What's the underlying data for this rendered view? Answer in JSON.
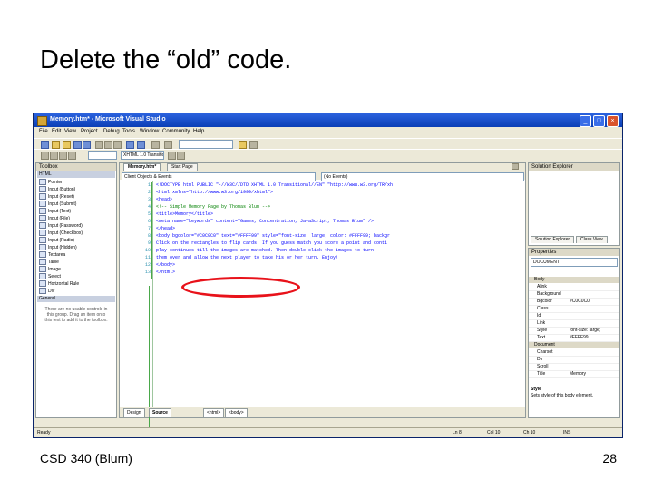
{
  "slide": {
    "title": "Delete the “old” code.",
    "footer_left": "CSD 340 (Blum)",
    "page_number": "28"
  },
  "window": {
    "title": "Memory.htm* - Microsoft Visual Studio",
    "menu": [
      "File",
      "Edit",
      "View",
      "Project",
      "Debug",
      "Tools",
      "Window",
      "Community",
      "Help"
    ],
    "toolbar_dropdown": "Client Objects & Events",
    "doc_dropdown": "(No Events)",
    "schema_dropdown": "XHTML 1.0 Transitional",
    "toolbox": {
      "title": "Toolbox",
      "group_html": "HTML",
      "items": [
        "Pointer",
        "Input (Button)",
        "Input (Reset)",
        "Input (Submit)",
        "Input (Text)",
        "Input (File)",
        "Input (Password)",
        "Input (Checkbox)",
        "Input (Radio)",
        "Input (Hidden)",
        "Textarea",
        "Table",
        "Image",
        "Select",
        "Horizontal Rule",
        "Div"
      ],
      "group_general": "General",
      "empty_message": "There are no usable controls in this group. Drag an item onto this text to add it to the toolbox."
    },
    "editor": {
      "tabs": [
        "Memory.htm*",
        "Start Page"
      ],
      "line_numbers": [
        "1",
        "2",
        "3",
        "4",
        "5",
        "6",
        "7",
        "8",
        "9",
        "10",
        "11",
        "12",
        "13"
      ],
      "lines": [
        "<!DOCTYPE html PUBLIC \"-//W3C//DTD XHTML 1.0 Transitional//EN\" \"http://www.w3.org/TR/xh",
        "<html xmlns=\"http://www.w3.org/1999/xhtml\">",
        "<head>",
        "  <!-- Simple Memory Page by Thomas Blum -->",
        "  <title>Memory</title>",
        "  <meta name=\"keywords\" content=\"Games, Concentration, JavaScript, Thomas Blum\" />",
        "</head>",
        "<body bgcolor=\"#C0C0C0\" text=\"#FFFF99\" style=\"font-size: large; color: #FFFF99; backgr",
        "  Click on the rectangles to flip cards. If you guess match you score a point and conti",
        "  play continues till the images are matched. Then double click the images to turn",
        "  them over and allow the next player to take his or her turn. Enjoy!",
        "</body>",
        "</html>"
      ],
      "bottom_tabs": [
        "Design",
        "Source",
        "<html>",
        "<body>"
      ]
    },
    "solution_explorer": {
      "title": "Solution Explorer",
      "tabs": [
        "Solution Explorer",
        "Class View"
      ]
    },
    "properties": {
      "title": "Properties",
      "selector": "DOCUMENT",
      "cat_body": "Body",
      "body_rows": [
        {
          "k": "Alink",
          "v": ""
        },
        {
          "k": "Background",
          "v": ""
        },
        {
          "k": "Bgcolor",
          "v": "#C0C0C0"
        },
        {
          "k": "Class",
          "v": ""
        },
        {
          "k": "Id",
          "v": ""
        },
        {
          "k": "Link",
          "v": ""
        },
        {
          "k": "Style",
          "v": "font-size: large;"
        },
        {
          "k": "Text",
          "v": "#FFFF99"
        }
      ],
      "cat_document": "Document",
      "doc_rows": [
        {
          "k": "Charset",
          "v": ""
        },
        {
          "k": "Dir",
          "v": ""
        },
        {
          "k": "Scroll",
          "v": ""
        },
        {
          "k": "Title",
          "v": "Memory"
        }
      ],
      "desc_title": "Style",
      "desc_text": "Sets style of this body element."
    },
    "status": {
      "left": "Ready",
      "ln": "Ln 8",
      "col": "Col 10",
      "ch": "Ch 10",
      "ins": "INS"
    }
  },
  "colors": {
    "oval": "#e8121a",
    "titlebar": "#2b62de",
    "tag": "#a31515",
    "comment": "#008000"
  }
}
